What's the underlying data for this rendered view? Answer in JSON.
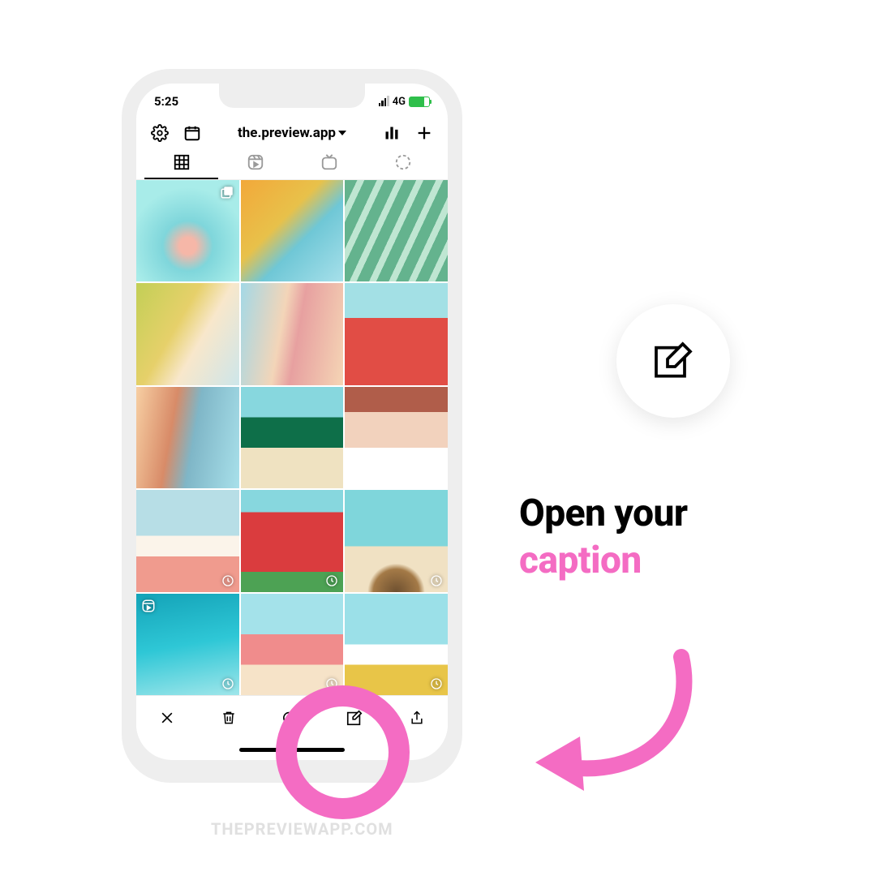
{
  "status": {
    "time": "5:25",
    "network": "4G"
  },
  "header": {
    "account": "the.preview.app"
  },
  "instruction": {
    "line1": "Open your",
    "line2": "caption"
  },
  "watermark": "THEPREVIEWAPP.COM"
}
